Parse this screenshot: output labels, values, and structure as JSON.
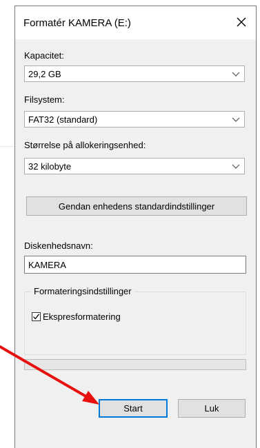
{
  "dialog": {
    "title": "Formatér KAMERA (E:)",
    "close_icon": "close-icon"
  },
  "capacity": {
    "label": "Kapacitet:",
    "value": "29,2 GB"
  },
  "filesystem": {
    "label": "Filsystem:",
    "value": "FAT32 (standard)"
  },
  "allocation": {
    "label": "Størrelse på allokeringsenhed:",
    "value": "32 kilobyte"
  },
  "restore_button": {
    "label": "Gendan enhedens standardindstillinger"
  },
  "volume": {
    "label": "Diskenhedsnavn:",
    "value": "KAMERA"
  },
  "format_options": {
    "title": "Formateringsindstillinger",
    "quick_format_label": "Ekspresformatering",
    "quick_format_checked": true
  },
  "progress": {
    "value": 0
  },
  "buttons": {
    "start_label": "Start",
    "close_label": "Luk"
  },
  "annotation": {
    "arrow_color": "#e8100e",
    "arrow_icon": "red-arrow-pointer"
  }
}
